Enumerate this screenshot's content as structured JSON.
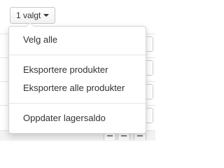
{
  "trigger": {
    "label": "1 valgt",
    "icon": "caret-down-icon"
  },
  "menu": {
    "items": [
      {
        "label": "Velg alle"
      },
      {
        "label": "Eksportere produkter"
      },
      {
        "label": "Eksportere alle produkter"
      },
      {
        "label": "Oppdater lagersaldo"
      }
    ]
  },
  "colors": {
    "text": "#333333",
    "border": "#d5d5d5",
    "divider": "#e5e5e5"
  }
}
